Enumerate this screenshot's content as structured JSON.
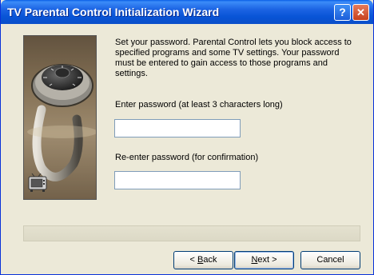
{
  "window": {
    "title": "TV Parental Control Initialization Wizard",
    "help_glyph": "?",
    "close_glyph": "✕"
  },
  "content": {
    "intro_text": "Set your password.  Parental Control lets you block access to specified programs and some TV settings.  Your password must be entered to gain access to those programs and settings.",
    "password_label": "Enter password (at least 3 characters long)",
    "password_value": "",
    "confirm_label": "Re-enter password (for confirmation)",
    "confirm_value": ""
  },
  "progress": {
    "fraction": 0
  },
  "buttons": {
    "back_prefix": "< ",
    "back_key": "B",
    "back_rest": "ack",
    "next_key": "N",
    "next_rest": "ext >",
    "cancel_label": "Cancel"
  },
  "icons": {
    "image": "padlock-photo",
    "tv": "tv-icon"
  },
  "colors": {
    "title_bar": "#0854d6",
    "dialog_bg": "#ece9d8",
    "input_border": "#7f9db9"
  }
}
